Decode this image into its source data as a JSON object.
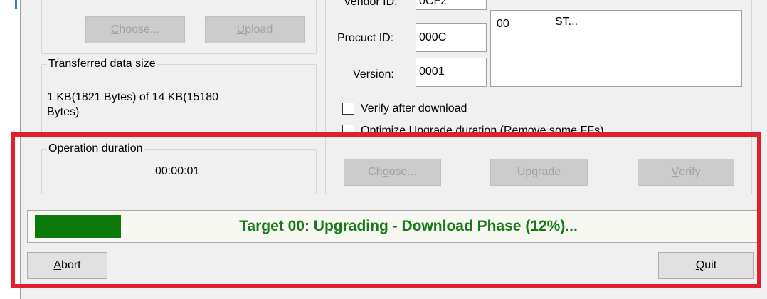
{
  "left_panel": {
    "choose_label": "Choose...",
    "choose_mnemonic": "C",
    "choose_rest": "hoose...",
    "upload_mnemonic": "U",
    "upload_rest": "pload",
    "transferred_legend": "Transferred data size",
    "transferred_line1": "1 KB(1821 Bytes) of 14 KB(15180",
    "transferred_line2": "Bytes)",
    "duration_legend": "Operation duration",
    "duration_value": "00:00:01"
  },
  "device_info": {
    "vendor_label_partial": "Vendor ID:",
    "vendor_value_partial": "0CF2",
    "product_label": "Procuct ID:",
    "product_value": "000C",
    "version_label": "Version:",
    "version_value": "0001",
    "target_list": {
      "col1": "00",
      "col2": "ST..."
    }
  },
  "options": {
    "verify_after_download": "Verify after download",
    "optimize_partial": "Optimize Upgrade duration (Remove some FFs)"
  },
  "upgrade_buttons": {
    "choose_prefix": "Ch",
    "choose_mnemonic": "o",
    "choose_rest": "ose...",
    "upgrade_prefix": "Up",
    "upgrade_mnemonic": "g",
    "upgrade_rest": "rade",
    "verify_mnemonic": "V",
    "verify_rest": "erify"
  },
  "progress": {
    "text": "Target 00: Upgrading - Download Phase (12%)...",
    "percent": 12,
    "fill_color": "#0b7a0b",
    "text_color": "#157a15"
  },
  "bottom_buttons": {
    "abort_mnemonic": "A",
    "abort_rest": "bort",
    "quit_mnemonic": "Q",
    "quit_rest": "uit"
  },
  "highlight_color": "#e0202b"
}
